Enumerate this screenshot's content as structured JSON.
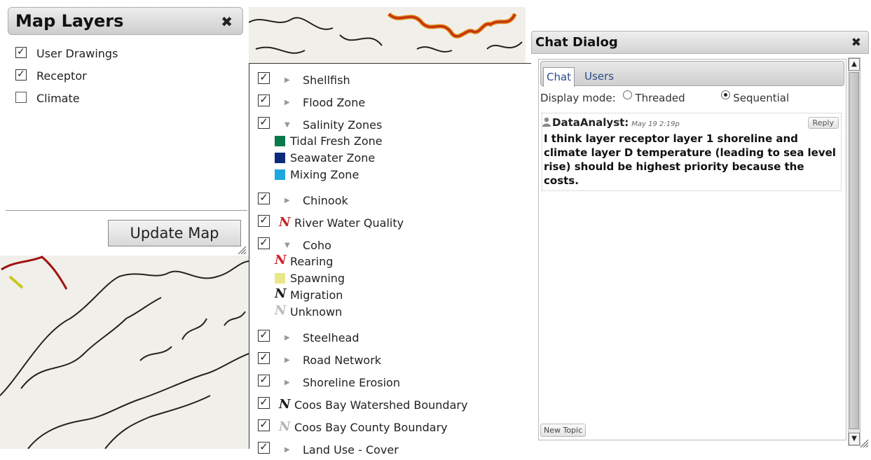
{
  "layers_panel": {
    "title": "Map Layers",
    "close_glyph": "✖",
    "items": [
      {
        "label": "User Drawings",
        "checked": true
      },
      {
        "label": "Receptor",
        "checked": true
      },
      {
        "label": "Climate",
        "checked": false
      }
    ],
    "update_button": "Update Map"
  },
  "layer_list": {
    "check_glyph": "☑",
    "collapsed_glyph": "▶",
    "expanded_glyph": "▼",
    "line_icon_glyph": "N",
    "items": [
      {
        "label": "Shellfish"
      },
      {
        "label": "Flood Zone"
      },
      {
        "label": "Salinity Zones",
        "expanded": true,
        "legend": [
          {
            "label": "Tidal Fresh Zone",
            "color": "#0b7a4a"
          },
          {
            "label": "Seawater Zone",
            "color": "#0a2a7a"
          },
          {
            "label": "Mixing Zone",
            "color": "#1ca7e0"
          }
        ]
      },
      {
        "label": "Chinook"
      },
      {
        "label": "River Water Quality",
        "icon_color": "#c0282a"
      },
      {
        "label": "Coho",
        "expanded": true,
        "legend": [
          {
            "label": "Rearing",
            "icon_color": "#d1202a"
          },
          {
            "label": "Spawning",
            "color": "#e8e88a"
          },
          {
            "label": "Migration",
            "icon_color": "#1a1a1a"
          },
          {
            "label": "Unknown",
            "icon_color": "#bbbbbb"
          }
        ]
      },
      {
        "label": "Steelhead"
      },
      {
        "label": "Road Network"
      },
      {
        "label": "Shoreline Erosion"
      },
      {
        "label": "Coos Bay Watershed Boundary",
        "icon_color": "#1a1a1a"
      },
      {
        "label": "Coos Bay County Boundary",
        "icon_color": "#b5b5b5"
      },
      {
        "label": "Land Use - Cover"
      }
    ]
  },
  "chat": {
    "title": "Chat Dialog",
    "close_glyph": "✖",
    "tabs": [
      "Chat",
      "Users"
    ],
    "active_tab": "Chat",
    "display_mode_label": "Display mode:",
    "modes": [
      {
        "label": "Threaded",
        "selected": false
      },
      {
        "label": "Sequential",
        "selected": true
      }
    ],
    "post": {
      "author": "DataAnalyst:",
      "time": "May 19 2:19p",
      "reply_label": "Reply",
      "text": "I think layer receptor layer 1 shoreline and climate layer D temperature (leading to sea level rise) should be highest priority because the costs."
    },
    "new_topic_label": "New Topic"
  },
  "colors": {
    "map_background": "#f1efe9",
    "river_highlight": "#e05a10",
    "river_red": "#b01818",
    "spawning_yellow": "#d4d420"
  }
}
